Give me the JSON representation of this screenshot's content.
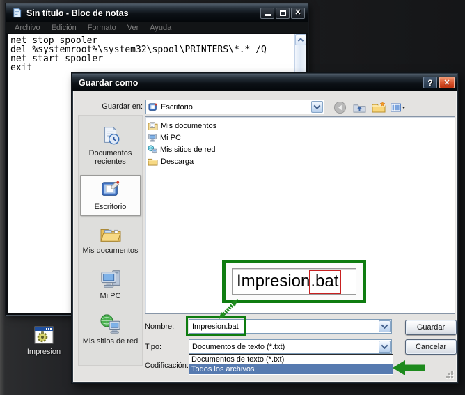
{
  "notepad": {
    "title": "Sin título - Bloc de notas",
    "menu": [
      "Archivo",
      "Edición",
      "Formato",
      "Ver",
      "Ayuda"
    ],
    "content_lines": [
      "net stop spooler",
      "del %systemroot%\\system32\\spool\\PRINTERS\\*.* /Q",
      "net start spooler",
      "exit"
    ],
    "close_glyph": "✕"
  },
  "dialog": {
    "title": "Guardar como",
    "help_glyph": "?",
    "close_glyph": "✕",
    "save_in_label": "Guardar en:",
    "save_in_value": "Escritorio",
    "places": [
      {
        "label": "Documentos recientes",
        "selected": false
      },
      {
        "label": "Escritorio",
        "selected": true
      },
      {
        "label": "Mis documentos",
        "selected": false
      },
      {
        "label": "Mi PC",
        "selected": false
      },
      {
        "label": "Mis sitios de red",
        "selected": false
      }
    ],
    "file_list": [
      {
        "label": "Mis documentos"
      },
      {
        "label": "Mi PC"
      },
      {
        "label": "Mis sitios de red"
      },
      {
        "label": "Descarga"
      }
    ],
    "name_label": "Nombre:",
    "name_value": "Impresion.bat",
    "type_label": "Tipo:",
    "type_value": "Documentos de texto (*.txt)",
    "encoding_label": "Codificación:",
    "dropdown_options": [
      {
        "label": "Documentos de texto (*.txt)",
        "selected": false
      },
      {
        "label": "Todos los archivos",
        "selected": true
      }
    ],
    "save_button": "Guardar",
    "cancel_button": "Cancelar"
  },
  "annotations": {
    "magnified_name": "Impresion",
    "magnified_ext": ".bat"
  },
  "desktop": {
    "icon_label": "Impresion"
  },
  "colors": {
    "annotation_green": "#0e7c10",
    "annotation_red": "#c82121",
    "selection_blue": "#567ab0",
    "close_button_red": "#dc5a33"
  }
}
